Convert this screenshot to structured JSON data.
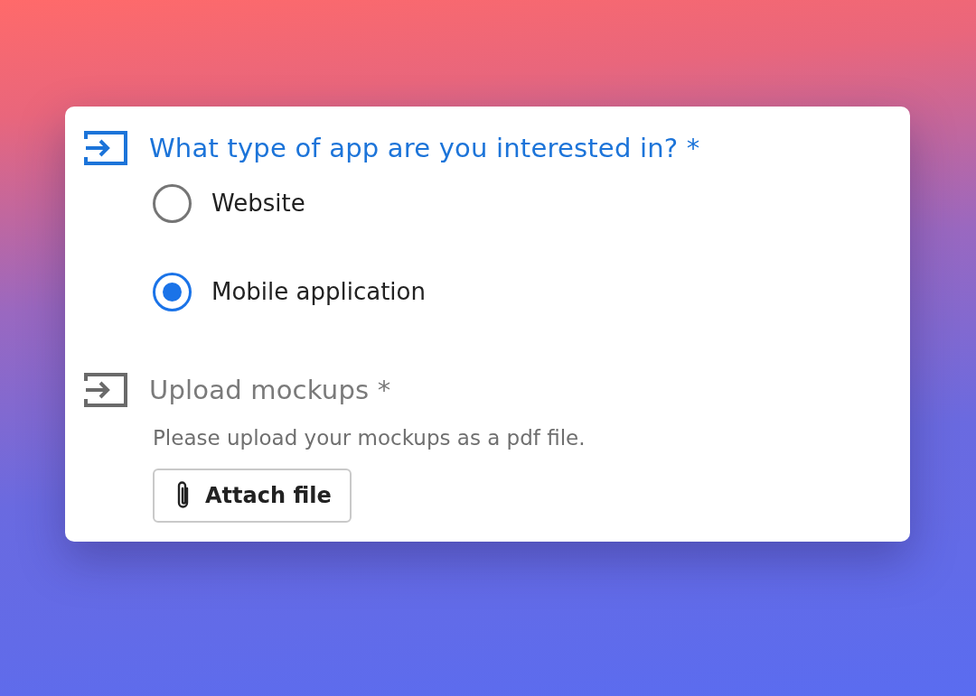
{
  "questions": [
    {
      "kind": "choice",
      "title": "What type of app are you interested in? *",
      "active": true,
      "options": [
        {
          "label": "Website",
          "selected": false
        },
        {
          "label": "Mobile application",
          "selected": true
        }
      ]
    },
    {
      "kind": "upload",
      "title": "Upload mockups *",
      "active": false,
      "description": "Please upload your mockups as a pdf file.",
      "button": "Attach file"
    }
  ]
}
